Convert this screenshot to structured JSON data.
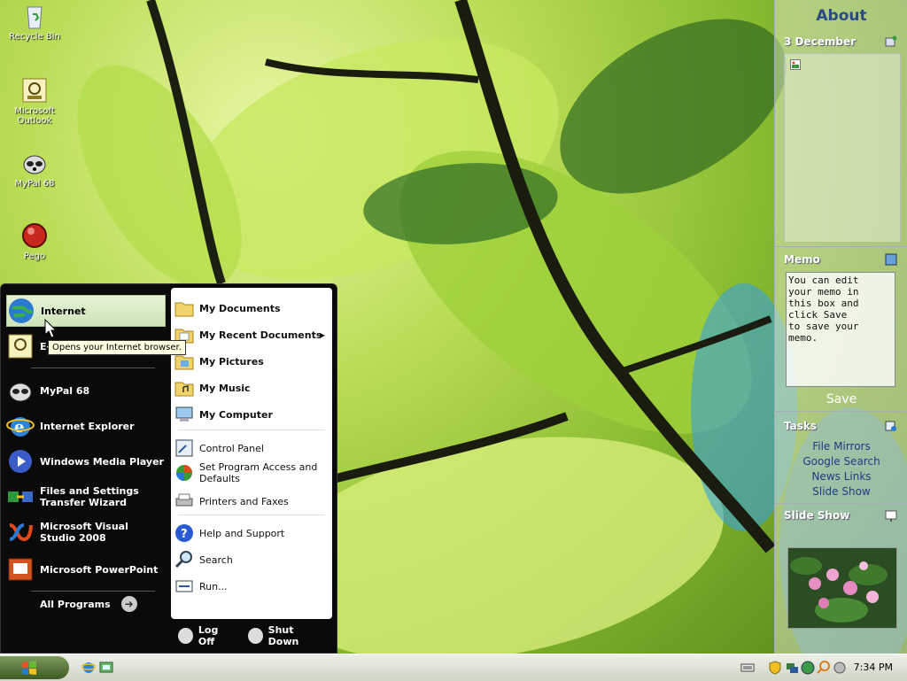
{
  "desktop": {
    "icons": [
      {
        "label": "Recycle Bin",
        "icon": "recycle-bin-icon"
      },
      {
        "label": "Microsoft Outlook",
        "icon": "outlook-icon"
      },
      {
        "label": "MyPal 68",
        "icon": "mypal-icon"
      },
      {
        "label": "Pego",
        "icon": "pego-icon"
      }
    ]
  },
  "start_menu": {
    "left_items": [
      {
        "label": "Internet",
        "icon": "globe-icon"
      },
      {
        "label": "E-mail",
        "icon": "outlook-icon"
      },
      {
        "label": "MyPal 68",
        "icon": "mypal-icon"
      },
      {
        "label": "Internet Explorer",
        "icon": "ie-icon"
      },
      {
        "label": "Windows Media Player",
        "icon": "media-player-icon"
      },
      {
        "label": "Files and Settings Transfer Wizard",
        "icon": "transfer-wizard-icon"
      },
      {
        "label": "Microsoft Visual Studio 2008",
        "icon": "visual-studio-icon"
      },
      {
        "label": "Microsoft PowerPoint",
        "icon": "powerpoint-icon"
      }
    ],
    "all_programs": "All Programs",
    "tooltip": "Opens your Internet browser.",
    "right_items": [
      {
        "label": "My Documents",
        "icon": "folder-icon"
      },
      {
        "label": "My Recent Documents",
        "icon": "recent-docs-icon"
      },
      {
        "label": "My Pictures",
        "icon": "pictures-folder-icon"
      },
      {
        "label": "My Music",
        "icon": "music-folder-icon"
      },
      {
        "label": "My Computer",
        "icon": "computer-icon"
      },
      {
        "label": "Control Panel",
        "icon": "control-panel-icon"
      },
      {
        "label": "Set Program Access and Defaults",
        "icon": "program-defaults-icon"
      },
      {
        "label": "Printers and Faxes",
        "icon": "printer-icon"
      },
      {
        "label": "Help and Support",
        "icon": "help-icon"
      },
      {
        "label": "Search",
        "icon": "search-icon"
      },
      {
        "label": "Run...",
        "icon": "run-icon"
      }
    ],
    "log_off": "Log Off",
    "shut_down": "Shut Down"
  },
  "sidebar": {
    "title": "About",
    "date": "3 December",
    "memo_title": "Memo",
    "memo_text": "You can edit\nyour memo in\nthis box and\nclick Save\nto save your\nmemo.",
    "save": "Save",
    "tasks_title": "Tasks",
    "tasks": [
      "File Mirrors",
      "Google Search",
      "News Links",
      "Slide Show"
    ],
    "slideshow_title": "Slide Show"
  },
  "taskbar": {
    "clock": "7:34 PM"
  }
}
